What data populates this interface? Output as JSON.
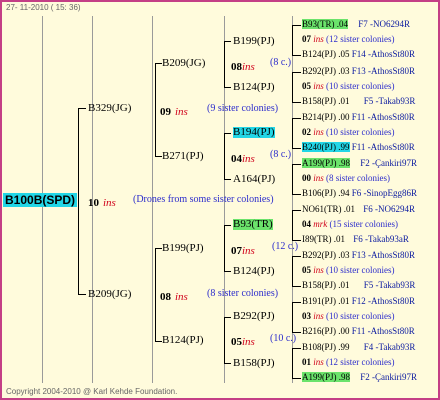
{
  "header": {
    "timestamp": "27- 11-2010 ( 15: 36)"
  },
  "footer": {
    "copyright": "Copyright 2004-2010 @ Karl Kehde Foundation."
  },
  "root": {
    "id": "B100B(SPD)",
    "mating_num": "10",
    "ins": "ins",
    "note": "(Drones from some sister colonies)"
  },
  "gen1": [
    {
      "id": "B329(JG)",
      "mating_num": "09",
      "ins": "ins",
      "note": "(9 sister colonies)"
    },
    {
      "id": "B209(JG)",
      "mating_num": "08",
      "ins": "ins",
      "note": "(8 sister colonies)"
    }
  ],
  "gen2": [
    {
      "id": "B209(JG)",
      "mating_num": "08",
      "ins": "ins",
      "note": "(8 c.)"
    },
    {
      "id": "B271(PJ)",
      "mating_num": "04",
      "ins": "ins",
      "note": "(8 c.)"
    },
    {
      "id": "B199(PJ)",
      "mating_num": "07",
      "ins": "ins",
      "note": "(12 c.)"
    },
    {
      "id": "B124(PJ)",
      "mating_num": "05",
      "ins": "ins",
      "note": "(10 c.)"
    }
  ],
  "gen3": [
    "B199(PJ)",
    "B124(PJ)",
    "B194(PJ)",
    "A164(PJ)",
    "B93(TR)",
    "B124(PJ)",
    "B292(PJ)",
    "B158(PJ)"
  ],
  "gen4": [
    {
      "id": "B93(TR) .04",
      "loc": "F7 -NO6294R"
    },
    {
      "num": "07",
      "ins": "ins",
      "note": "(12 sister colonies)"
    },
    {
      "id": "B124(PJ) .05",
      "loc": "F14 -AthosSt80R"
    },
    {
      "id": "B292(PJ) .03",
      "loc": "F13 -AthosSt80R"
    },
    {
      "num": "05",
      "ins": "ins",
      "note": "(10 sister colonies)"
    },
    {
      "id": "B158(PJ) .01",
      "loc": "F5 -Takab93R"
    },
    {
      "id": "B214(PJ) .00",
      "loc": "F11 -AthosSt80R"
    },
    {
      "num": "02",
      "ins": "ins",
      "note": "(10 sister colonies)"
    },
    {
      "id": "B240(PJ) .99",
      "loc": "F11 -AthosSt80R"
    },
    {
      "id": "A199(PJ) .98",
      "loc": "F2 -Çankiri97R"
    },
    {
      "num": "00",
      "ins": "ins",
      "note": "(8 sister colonies)"
    },
    {
      "id": "B106(PJ) .94",
      "loc": "F6 -SinopEgg86R"
    },
    {
      "id": "NO61(TR) .01",
      "loc": "F6 -NO6294R"
    },
    {
      "num": "04",
      "ins": "mrk",
      "note": "(15 sister colonies)"
    },
    {
      "id": "I89(TR) .01",
      "loc": "F6 -Takab93aR"
    },
    {
      "id": "B292(PJ) .03",
      "loc": "F13 -AthosSt80R"
    },
    {
      "num": "05",
      "ins": "ins",
      "note": "(10 sister colonies)"
    },
    {
      "id": "B158(PJ) .01",
      "loc": "F5 -Takab93R"
    },
    {
      "id": "B191(PJ) .01",
      "loc": "F12 -AthosSt80R"
    },
    {
      "num": "03",
      "ins": "ins",
      "note": "(10 sister colonies)"
    },
    {
      "id": "B216(PJ) .00",
      "loc": "F11 -AthosSt80R"
    },
    {
      "id": "B108(PJ) .99",
      "loc": "F4 -Takab93R"
    },
    {
      "num": "01",
      "ins": "ins",
      "note": "(12 sister colonies)"
    },
    {
      "id": "A199(PJ) .98",
      "loc": "F2 -Çankiri97R"
    }
  ],
  "colors": {
    "border": "#c43f86",
    "background": "#fffbdc",
    "cyan_highlight": "#22d6e6",
    "green_highlight": "#6be36b",
    "ins_red": "#d0021b",
    "note_blue": "#2c2ccc"
  }
}
